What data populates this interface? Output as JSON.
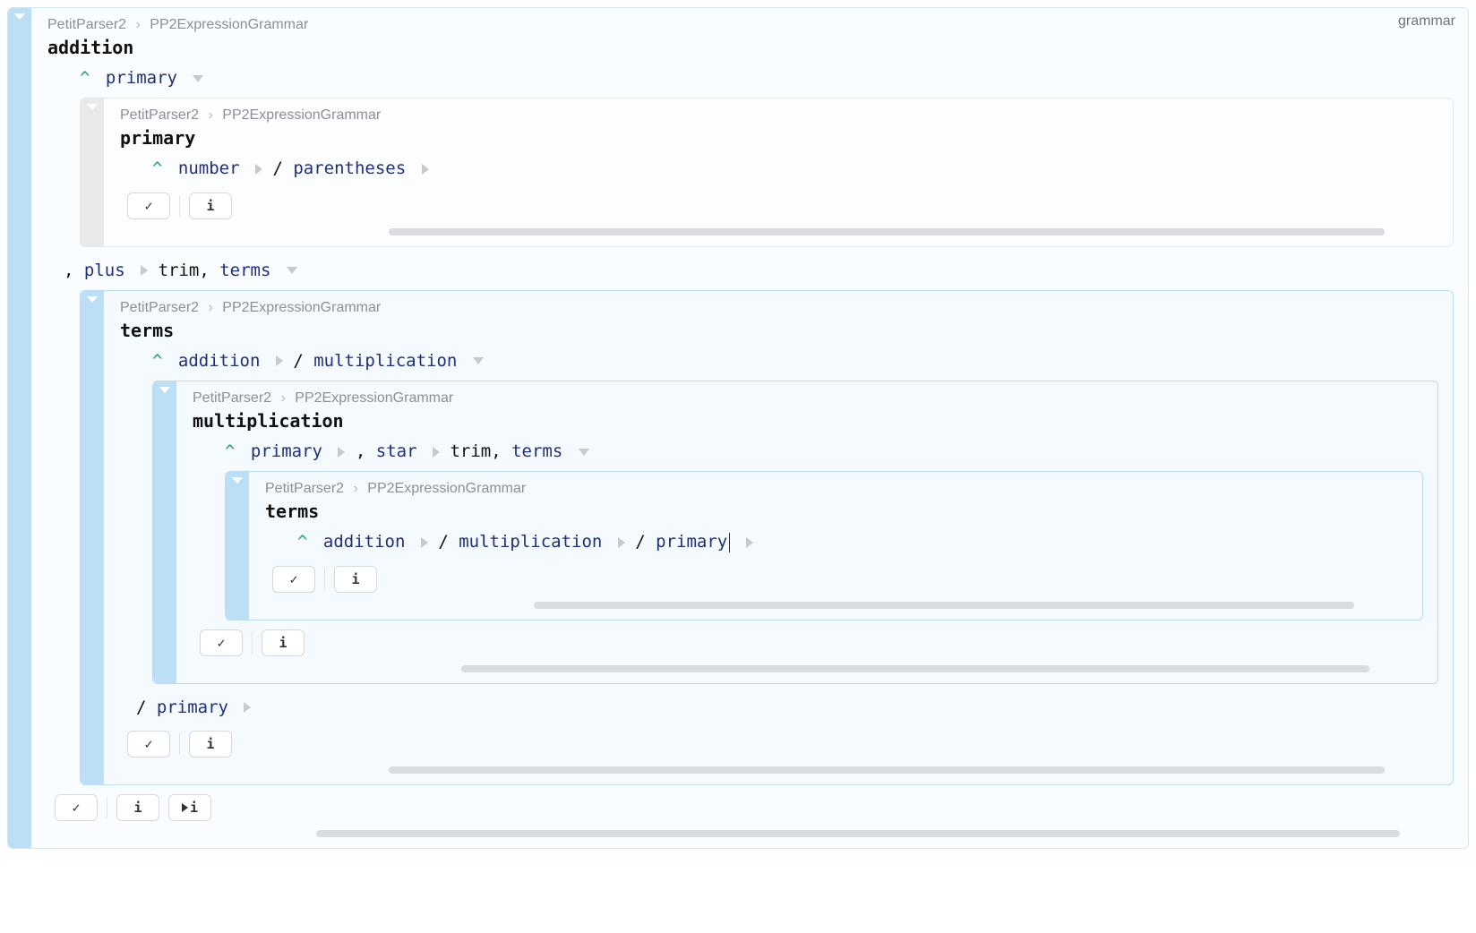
{
  "tag": "grammar",
  "buttons": {
    "info": "i",
    "play_info": "i"
  },
  "root": {
    "crumb_pkg": "PetitParser2",
    "crumb_cls": "PP2ExpressionGrammar",
    "title": "addition",
    "line1_kw": "primary",
    "line2_prefix": ", ",
    "line2_kw1": "plus",
    "line2_txt": "  trim, ",
    "line2_kw2": "terms",
    "line3_prefix": "/ ",
    "line3_kw": "primary"
  },
  "primaryPanel": {
    "crumb_pkg": "PetitParser2",
    "crumb_cls": "PP2ExpressionGrammar",
    "title": "primary",
    "kw1": "number",
    "sep": "  / ",
    "kw2": "parentheses"
  },
  "termsPanel": {
    "crumb_pkg": "PetitParser2",
    "crumb_cls": "PP2ExpressionGrammar",
    "title": "terms",
    "kw1": "addition",
    "sep": "  / ",
    "kw2": "multiplication"
  },
  "multPanel": {
    "crumb_pkg": "PetitParser2",
    "crumb_cls": "PP2ExpressionGrammar",
    "title": "multiplication",
    "kw1": "primary",
    "mid1": " , ",
    "kw2": "star",
    "mid2": "  trim, ",
    "kw3": "terms"
  },
  "innerTermsPanel": {
    "crumb_pkg": "PetitParser2",
    "crumb_cls": "PP2ExpressionGrammar",
    "title": "terms",
    "kw1": "addition",
    "sep1": "  / ",
    "kw2": "multiplication",
    "sep2": "  / ",
    "kw3": "primary"
  }
}
